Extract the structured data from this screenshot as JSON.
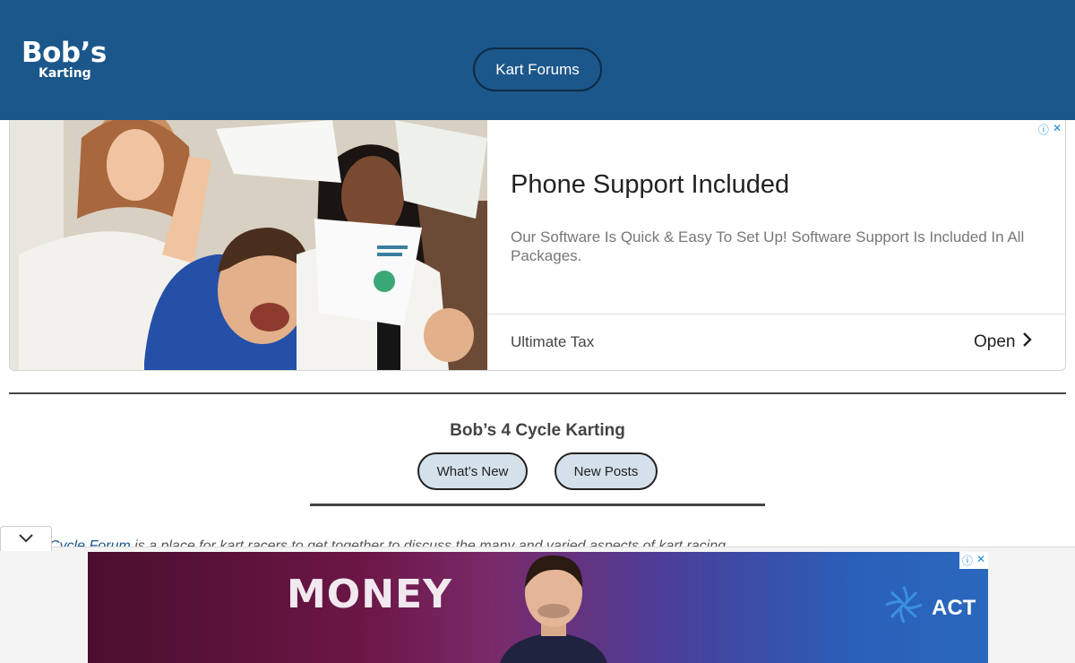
{
  "header": {
    "logo_main": "Bob’s",
    "logo_sub": "Karting",
    "forum_button": "Kart Forums",
    "bg_color": "#1b578a"
  },
  "ad_top": {
    "headline": "Phone Support Included",
    "description": "Our Software Is Quick & Easy To Set Up! Software Support Is Included In All Packages.",
    "advertiser": "Ultimate Tax",
    "cta": "Open",
    "icons": [
      "adchoices-info-icon",
      "close-icon",
      "chevron-right-icon"
    ]
  },
  "section": {
    "title": "Bob’s 4 Cycle Karting",
    "buttons": [
      {
        "label": "What’s New"
      },
      {
        "label": "New Posts"
      }
    ]
  },
  "intro": {
    "link_text": "Cycle Forum",
    "text": " is a place for kart racers to get together to discuss the many and varied aspects of kart racing."
  },
  "ad_bottom": {
    "headline": "MONEY",
    "brand": "ACT",
    "icons": [
      "adchoices-info-icon",
      "close-icon",
      "act-logo-icon"
    ]
  },
  "collapse_toggle": {
    "icon": "chevron-down-icon"
  }
}
